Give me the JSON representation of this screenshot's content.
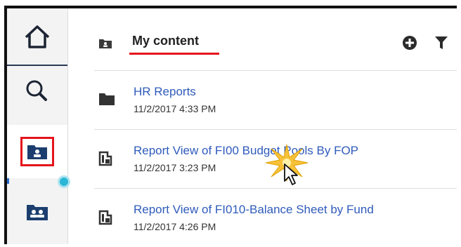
{
  "header": {
    "title": "My content",
    "add_icon": "plus-circle-icon",
    "filter_icon": "filter-funnel-icon",
    "title_icon": "my-content-folder-icon"
  },
  "sidebar": {
    "items": [
      {
        "icon": "home-icon"
      },
      {
        "icon": "search-icon"
      },
      {
        "icon": "my-content-icon",
        "active": true
      },
      {
        "icon": "team-content-icon"
      }
    ]
  },
  "content": {
    "items": [
      {
        "name": "HR Reports",
        "date": "11/2/2017 4:33 PM",
        "icon": "folder-icon"
      },
      {
        "name": "Report View of FI00    Budget Pools By FOP",
        "date": "11/2/2017 3:23 PM",
        "icon": "report-view-icon"
      },
      {
        "name": "Report View of FI010-Balance Sheet by Fund",
        "date": "11/2/2017 4:26 PM",
        "icon": "report-view-icon"
      }
    ]
  },
  "colors": {
    "link": "#2f5bbb",
    "highlight_red": "#e4141b",
    "rail_bg": "#f3f3f3",
    "active_blue": "#2d6fcf",
    "notify_dot": "#2bb7d6"
  }
}
